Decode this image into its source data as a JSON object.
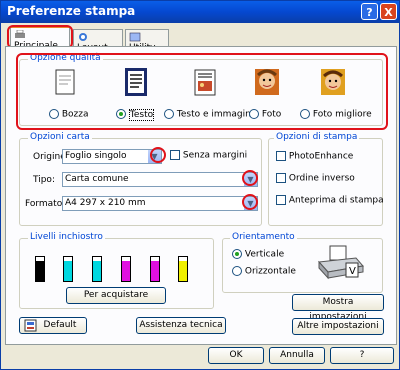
{
  "window": {
    "title": "Preferenze stampa",
    "help_label": "?",
    "close_label": "X"
  },
  "tabs": [
    {
      "label": "Principale",
      "selected": true
    },
    {
      "label": "Layout",
      "selected": false
    },
    {
      "label": "Utility",
      "selected": false
    }
  ],
  "quality": {
    "label": "Opzione qualità",
    "options": [
      {
        "label": "Bozza",
        "selected": false
      },
      {
        "label": "Testo",
        "selected": true
      },
      {
        "label": "Testo e immagine",
        "selected": false
      },
      {
        "label": "Foto",
        "selected": false
      },
      {
        "label": "Foto migliore",
        "selected": false
      }
    ]
  },
  "paper": {
    "label": "Opzioni carta",
    "source_label": "Origine:",
    "source_value": "Foglio singolo",
    "borderless_label": "Senza margini",
    "type_label": "Tipo:",
    "type_value": "Carta comune",
    "format_label": "Formato:",
    "format_value": "A4 297 x 210 mm"
  },
  "print_options": {
    "label": "Opzioni di stampa",
    "items": [
      "PhotoEnhance",
      "Ordine inverso",
      "Anteprima di stampa"
    ]
  },
  "ink": {
    "label": "Livelli inchiostro",
    "buy_label": "Per acquistare",
    "cartridges": [
      {
        "color": "#000000",
        "level": 0.85
      },
      {
        "color": "#00d8e0",
        "level": 0.85
      },
      {
        "color": "#00d8e0",
        "level": 0.85
      },
      {
        "color": "#e010e0",
        "level": 0.85
      },
      {
        "color": "#e010e0",
        "level": 0.85
      },
      {
        "color": "#f0f000",
        "level": 0.85
      }
    ]
  },
  "orientation": {
    "label": "Orientamento",
    "options": [
      {
        "label": "Verticale",
        "selected": true
      },
      {
        "label": "Orizzontale",
        "selected": false
      }
    ]
  },
  "buttons": {
    "show_settings": "Mostra impostazioni",
    "other_settings": "Altre impostazioni",
    "default": "Default",
    "support": "Assistenza tecnica",
    "ok": "OK",
    "cancel": "Annulla",
    "help": "?"
  },
  "colors": {
    "highlight": "#e0121a",
    "group_label": "#0046d5",
    "title_bar": "#0548d0"
  }
}
